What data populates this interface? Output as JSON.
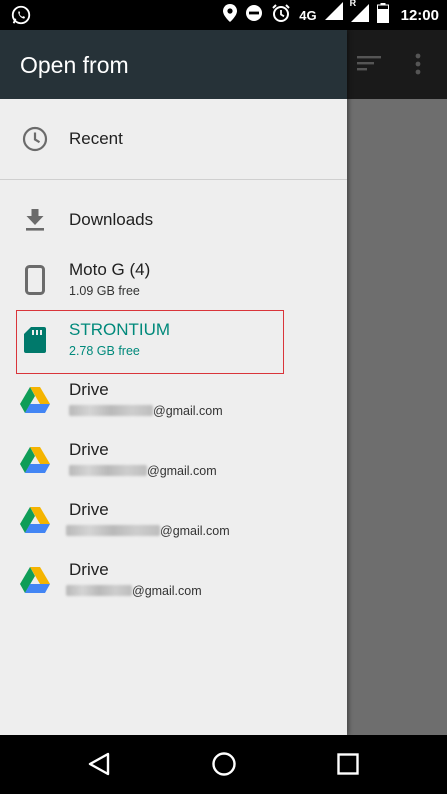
{
  "status_bar": {
    "app_icon": "whatsapp-icon",
    "icons": [
      "location-icon",
      "do-not-disturb-icon",
      "alarm-icon"
    ],
    "network": "4G",
    "roaming": "R",
    "time": "12:00"
  },
  "drawer": {
    "title": "Open from",
    "recent": {
      "label": "Recent",
      "icon": "clock-icon"
    },
    "roots": [
      {
        "title": "Downloads",
        "icon": "download-icon"
      },
      {
        "title": "Moto G (4)",
        "summary": "1.09 GB free",
        "icon": "phone-icon"
      },
      {
        "title": "STRONTIUM",
        "summary": "2.78 GB free",
        "icon": "sd-card-icon",
        "selected": true
      },
      {
        "title": "Drive",
        "summary": "@gmail.com",
        "icon": "drive-icon"
      },
      {
        "title": "Drive",
        "summary": "@gmail.com",
        "icon": "drive-icon"
      },
      {
        "title": "Drive",
        "summary": "@gmail.com",
        "icon": "drive-icon"
      },
      {
        "title": "Drive",
        "summary": "@gmail.com",
        "icon": "drive-icon"
      }
    ]
  },
  "toolbar_icons": [
    "sort-icon",
    "more-vert-icon"
  ],
  "nav_bar": [
    "back-icon",
    "home-icon",
    "recents-icon"
  ],
  "colors": {
    "drawer_header": "#263238",
    "accent": "#00897b",
    "highlight": "#d9343a"
  }
}
